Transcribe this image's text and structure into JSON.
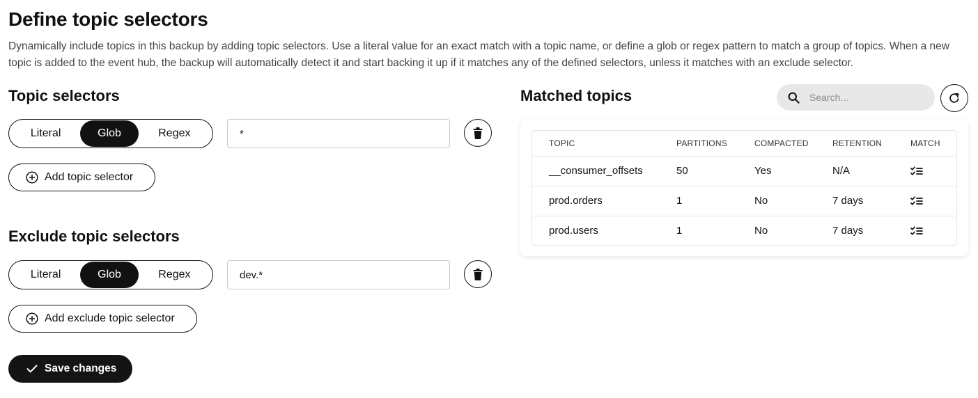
{
  "page": {
    "title": "Define topic selectors",
    "description": "Dynamically include topics in this backup by adding topic selectors. Use a literal value for an exact match with a topic name, or define a glob or regex pattern to match a group of topics. When a new topic is added to the event hub, the backup will automatically detect it and start backing it up if it matches any of the defined selectors, unless it matches with an exclude selector."
  },
  "topic_selectors": {
    "title": "Topic selectors",
    "modes": [
      "Literal",
      "Glob",
      "Regex"
    ],
    "selected_mode": "Glob",
    "value": "*",
    "add_label": "Add topic selector"
  },
  "exclude_selectors": {
    "title": "Exclude topic selectors",
    "modes": [
      "Literal",
      "Glob",
      "Regex"
    ],
    "selected_mode": "Glob",
    "value": "dev.*",
    "add_label": "Add exclude topic selector"
  },
  "save_label": "Save changes",
  "matched": {
    "title": "Matched topics",
    "search_placeholder": "Search...",
    "columns": [
      "TOPIC",
      "PARTITIONS",
      "COMPACTED",
      "RETENTION",
      "MATCH"
    ],
    "rows": [
      {
        "topic": "__consumer_offsets",
        "partitions": "50",
        "compacted": "Yes",
        "retention": "N/A"
      },
      {
        "topic": "prod.orders",
        "partitions": "1",
        "compacted": "No",
        "retention": "7 days"
      },
      {
        "topic": "prod.users",
        "partitions": "1",
        "compacted": "No",
        "retention": "7 days"
      }
    ]
  },
  "icons": {
    "delete": "trash-icon",
    "add": "plus-circle-icon",
    "save": "checkmark-icon",
    "search": "search-icon",
    "refresh": "refresh-icon",
    "match": "check-list-icon"
  },
  "colors": {
    "primary": "#111111",
    "search_bg": "#e8e8e8",
    "border": "#c9c9c9"
  }
}
